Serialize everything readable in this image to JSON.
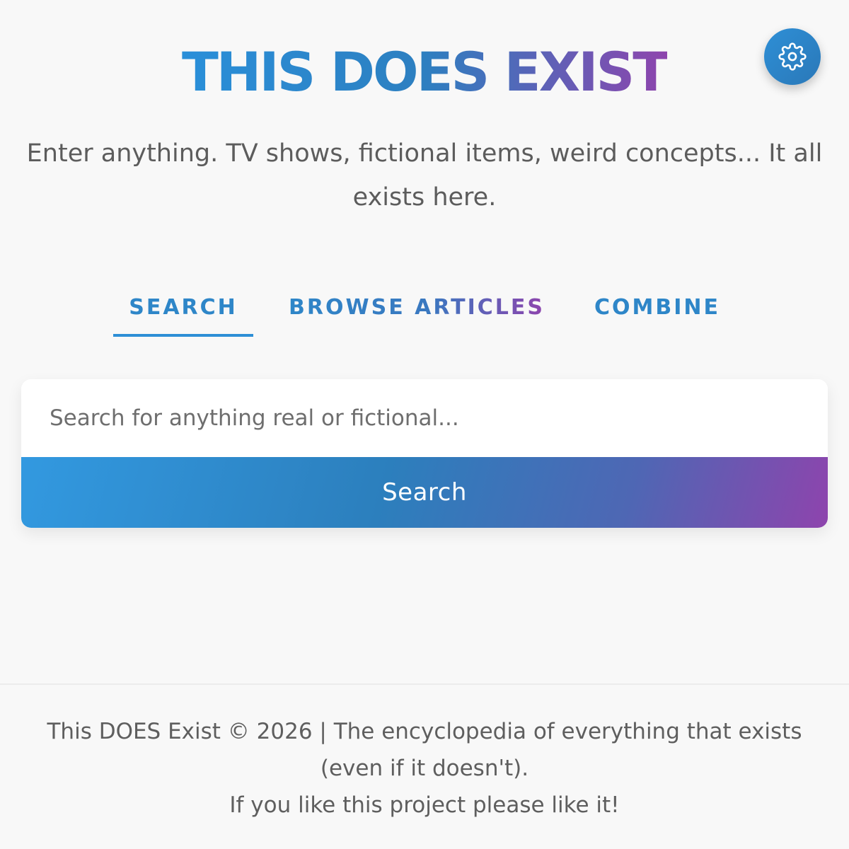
{
  "header": {
    "title": "THIS DOES EXIST",
    "subtitle": "Enter anything. TV shows, fictional items, weird concepts... It all exists here.",
    "settings_icon": "gear-icon"
  },
  "tabs": [
    {
      "label": "SEARCH",
      "active": true
    },
    {
      "label": "BROWSE ARTICLES",
      "active": false
    },
    {
      "label": "COMBINE",
      "active": false
    }
  ],
  "search": {
    "placeholder": "Search for anything real or fictional...",
    "value": "",
    "button_label": "Search"
  },
  "footer": {
    "copyright": "This DOES Exist © 2026 | The encyclopedia of everything that exists (even if it doesn't).",
    "like_text": "If you like this project please like it!"
  },
  "colors": {
    "accent_blue": "#2e8fd6",
    "accent_purple": "#8e44ad",
    "background": "#f8f8f8"
  }
}
